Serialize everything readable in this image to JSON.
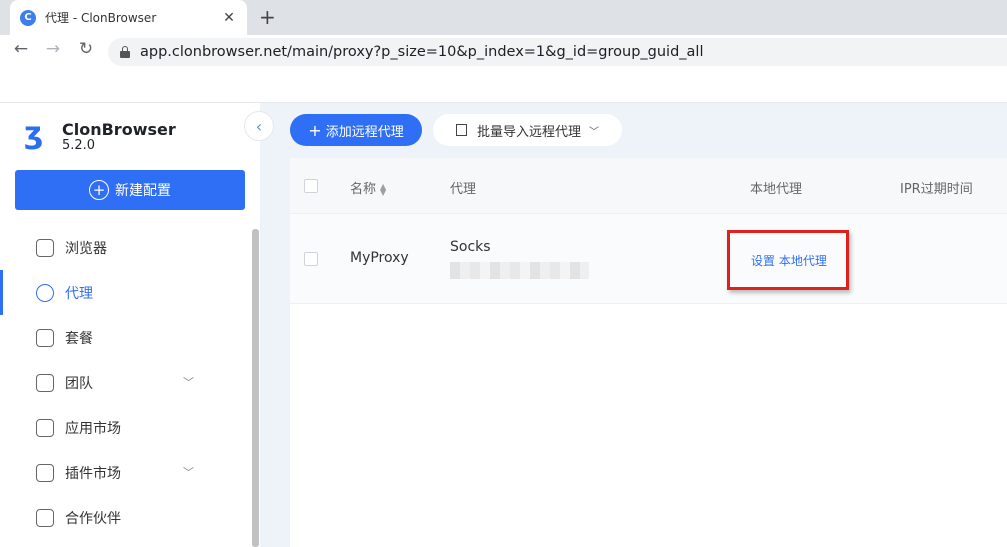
{
  "browser": {
    "tab_title": "代理 - ClonBrowser",
    "tab_close": "✕",
    "new_tab": "+",
    "url": "app.clonbrowser.net/main/proxy?p_size=10&p_index=1&g_id=group_guid_all"
  },
  "app": {
    "logo_name": "ClonBrowser",
    "version": "5.2.0",
    "new_profile_label": "新建配置",
    "menu": [
      {
        "label": "浏览器",
        "icon": "browser-icon"
      },
      {
        "label": "代理",
        "icon": "globe-icon",
        "active": true
      },
      {
        "label": "套餐",
        "icon": "wallet-icon"
      },
      {
        "label": "团队",
        "icon": "team-icon",
        "has_submenu": true
      },
      {
        "label": "应用市场",
        "icon": "cube-icon"
      },
      {
        "label": "插件市场",
        "icon": "puzzle-icon",
        "has_submenu": true
      },
      {
        "label": "合作伙伴",
        "icon": "cube-icon"
      }
    ]
  },
  "toolbar": {
    "add_proxy_label": "添加远程代理",
    "import_label": "批量导入远程代理"
  },
  "table": {
    "headers": [
      "名称",
      "代理",
      "本地代理",
      "IPR过期时间"
    ],
    "rows": [
      {
        "name": "MyProxy",
        "proxy_type": "Socks",
        "local_proxy_action": "设置 本地代理"
      }
    ]
  },
  "colors": {
    "accent": "#2f6ff5",
    "highlight": "#e0201d"
  }
}
